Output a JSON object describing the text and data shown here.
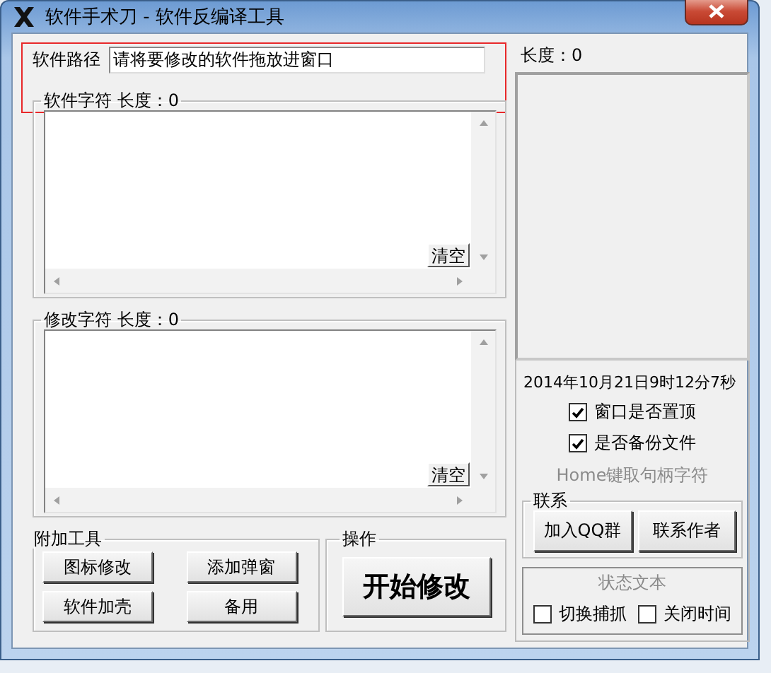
{
  "window": {
    "title": "软件手术刀 - 软件反编译工具"
  },
  "path": {
    "label": "软件路径",
    "value": "请将要修改的软件拖放进窗口"
  },
  "sections": [
    {
      "title": "软件字符 长度：0",
      "clear": "清空"
    },
    {
      "title": "修改字符 长度：0",
      "clear": "清空"
    }
  ],
  "tools": {
    "title": "附加工具",
    "buttons": [
      "图标修改",
      "添加弹窗",
      "软件加壳",
      "备用"
    ]
  },
  "action": {
    "title": "操作",
    "button": "开始修改"
  },
  "side": {
    "length": "长度：0",
    "datetime": "2014年10月21日9时12分7秒",
    "options": [
      {
        "label": "窗口是否置顶",
        "checked": true
      },
      {
        "label": "是否备份文件",
        "checked": true
      }
    ],
    "hint": "Home键取句柄字符",
    "contact": {
      "title": "联系",
      "buttons": [
        "加入QQ群",
        "联系作者"
      ]
    },
    "status": {
      "text": "状态文本",
      "options": [
        {
          "label": "切换捕抓",
          "checked": false
        },
        {
          "label": "关闭时间",
          "checked": false
        }
      ]
    }
  }
}
